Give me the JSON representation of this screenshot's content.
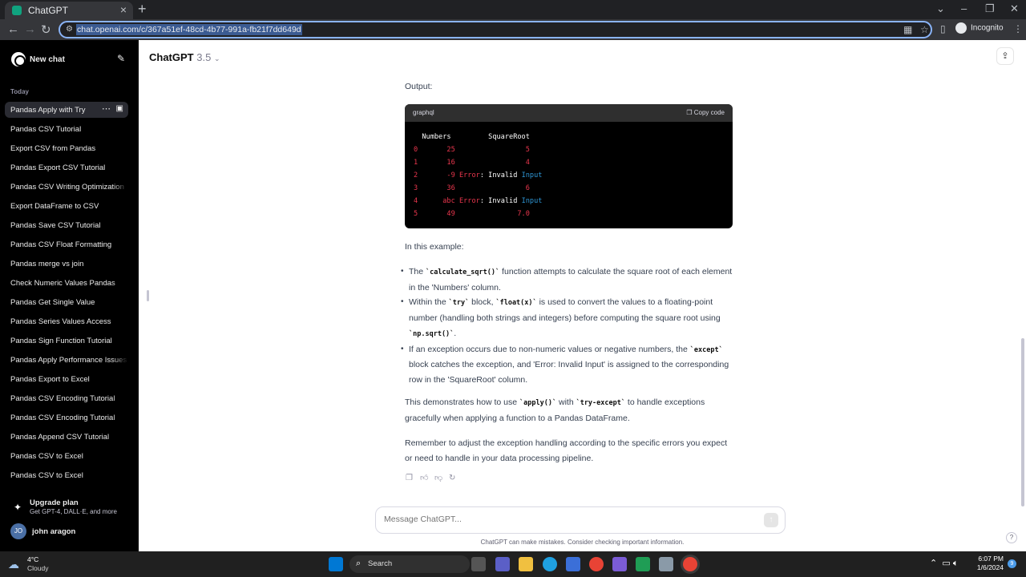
{
  "browser": {
    "tab_title": "ChatGPT",
    "url": "chat.openai.com/c/367a51ef-48cd-4b77-991a-fb21f7dd649d",
    "profile": "Incognito"
  },
  "sidebar": {
    "new_chat": "New chat",
    "section": "Today",
    "items": [
      {
        "label": "Pandas Apply with Try"
      },
      {
        "label": "Pandas CSV Tutorial"
      },
      {
        "label": "Export CSV from Pandas"
      },
      {
        "label": "Pandas Export CSV Tutorial"
      },
      {
        "label": "Pandas CSV Writing Optimization"
      },
      {
        "label": "Export DataFrame to CSV"
      },
      {
        "label": "Pandas Save CSV Tutorial"
      },
      {
        "label": "Pandas CSV Float Formatting"
      },
      {
        "label": "Pandas merge vs join"
      },
      {
        "label": "Check Numeric Values Pandas"
      },
      {
        "label": "Pandas Get Single Value"
      },
      {
        "label": "Pandas Series Values Access"
      },
      {
        "label": "Pandas Sign Function Tutorial"
      },
      {
        "label": "Pandas Apply Performance Issues"
      },
      {
        "label": "Pandas Export to Excel"
      },
      {
        "label": "Pandas CSV Encoding Tutorial"
      },
      {
        "label": "Pandas CSV Encoding Tutorial"
      },
      {
        "label": "Pandas Append CSV Tutorial"
      },
      {
        "label": "Pandas CSV to Excel"
      },
      {
        "label": "Pandas CSV to Excel"
      }
    ],
    "upgrade_title": "Upgrade plan",
    "upgrade_sub": "Get GPT-4, DALL·E, and more",
    "user_initials": "JO",
    "user_name": "john aragon"
  },
  "header": {
    "model": "ChatGPT",
    "version": "3.5"
  },
  "message": {
    "output_label": "Output:",
    "code_lang": "graphql",
    "copy_label": "Copy code",
    "table_header": [
      "Numbers",
      "SquareRoot"
    ],
    "rows": [
      {
        "idx": "0",
        "num": "25",
        "root": "5"
      },
      {
        "idx": "1",
        "num": "16",
        "root": "4"
      },
      {
        "idx": "2",
        "num": "-9",
        "root": "Error: Invalid Input"
      },
      {
        "idx": "3",
        "num": "36",
        "root": "6"
      },
      {
        "idx": "4",
        "num": "abc",
        "root": "Error: Invalid Input"
      },
      {
        "idx": "5",
        "num": "49",
        "root": "7.0"
      }
    ],
    "intro": "In this example:",
    "b1_code": "`calculate_sqrt()`",
    "b1_pre": "The ",
    "b1_post": " function attempts to calculate the square root of each element in the 'Numbers' column.",
    "b2_pre": "Within the ",
    "b2_code1": "`try`",
    "b2_mid": " block, ",
    "b2_code2": "`float(x)`",
    "b2_post": " is used to convert the values to a floating-point number (handling both strings and integers) before computing the square root using ",
    "b2_code3": "`np.sqrt()`",
    "b2_end": ".",
    "b3_pre": "If an exception occurs due to non-numeric values or negative numbers, the ",
    "b3_code": "`except`",
    "b3_post": " block catches the exception, and 'Error: Invalid Input' is assigned to the corresponding row in the 'SquareRoot' column.",
    "p2_pre": "This demonstrates how to use ",
    "p2_code1": "`apply()`",
    "p2_mid": " with ",
    "p2_code2": "`try-except`",
    "p2_post": " to handle exceptions gracefully when applying a function to a Pandas DataFrame.",
    "p3": "Remember to adjust the exception handling according to the specific errors you expect or need to handle in your data processing pipeline."
  },
  "composer": {
    "placeholder": "Message ChatGPT..."
  },
  "disclaimer": "ChatGPT can make mistakes. Consider checking important information.",
  "taskbar": {
    "temp": "4°C",
    "weather": "Cloudy",
    "search": "Search",
    "time": "6:07 PM",
    "date": "1/6/2024",
    "notifications": "9"
  }
}
